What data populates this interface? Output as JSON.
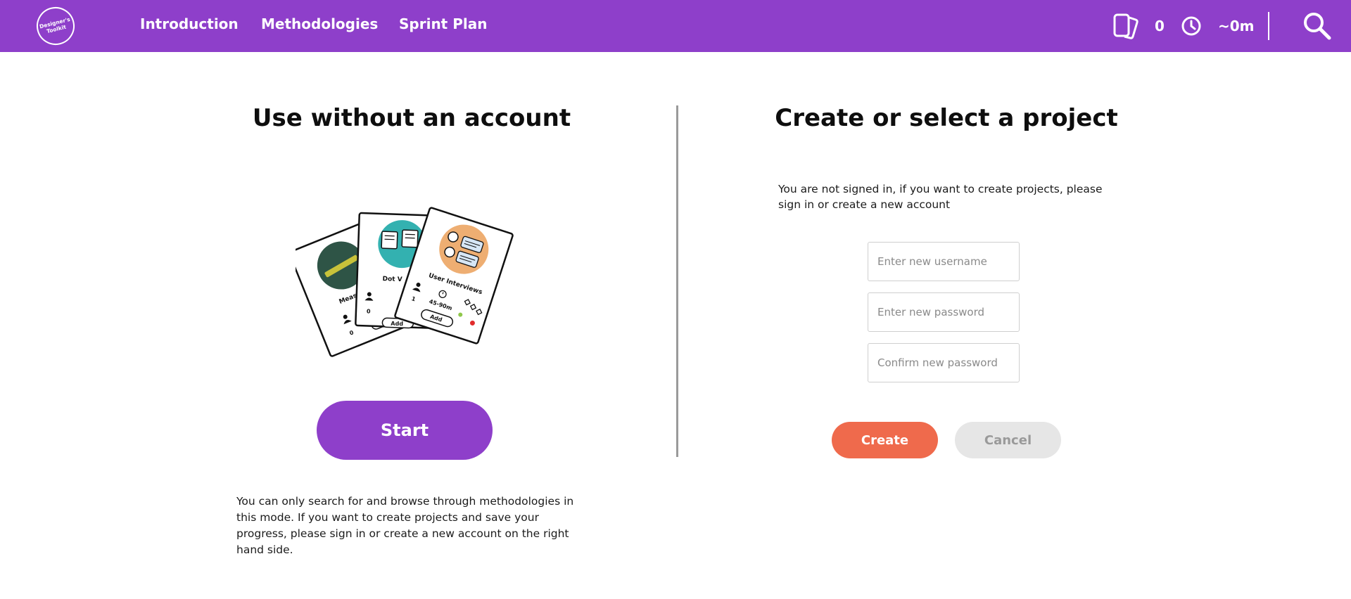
{
  "header": {
    "logo_text": "Designer's Toolkit",
    "nav": [
      "Introduction",
      "Methodologies",
      "Sprint Plan"
    ],
    "cards_count": "0",
    "time_estimate": "~0m"
  },
  "left": {
    "title": "Use without an account",
    "cards": {
      "back_title": "Meas",
      "back_count": "0",
      "back_add": "Ad",
      "middle_title": "Dot V",
      "middle_count": "0",
      "middle_add": "Add",
      "front_title": "User Interviews",
      "front_count": "1",
      "front_time": "45-90m",
      "front_add": "Add"
    },
    "start_label": "Start",
    "note": "You can only search for and browse through methodologies in this mode. If you want to create projects and save your progress, please sign in or create a new account on the right hand side."
  },
  "right": {
    "title": "Create or select a project",
    "note": "You are not signed in, if you want to create projects, please sign in or create a new account",
    "username_placeholder": "Enter new username",
    "password_placeholder": "Enter new password",
    "confirm_placeholder": "Confirm new password",
    "create_label": "Create",
    "cancel_label": "Cancel"
  },
  "colors": {
    "brand": "#8e3fca",
    "create": "#ef6a4c",
    "cancel": "#e6e6e6"
  }
}
